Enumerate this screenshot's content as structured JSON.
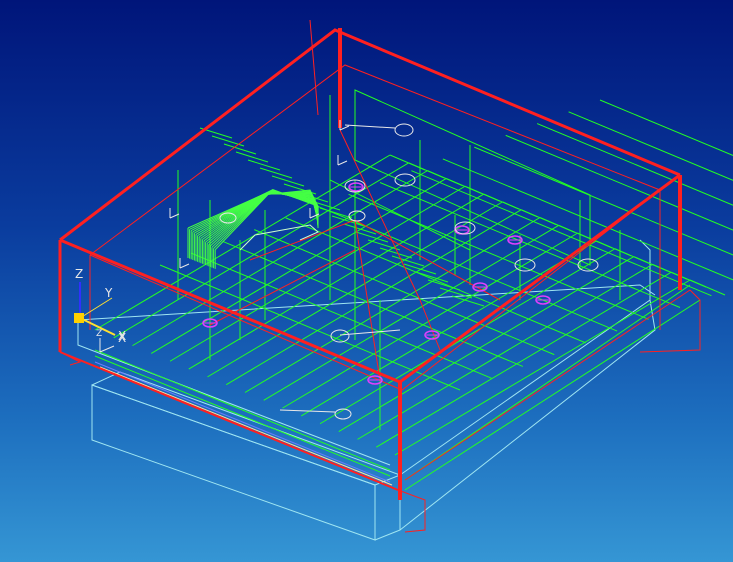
{
  "viewport": {
    "background_top": "#00157a",
    "background_bottom": "#3596d4"
  },
  "colors": {
    "frame": "#ff2020",
    "toolpath": "#22ff22",
    "toolpath_dense": "#44ff44",
    "stock": "#9fe6f2",
    "marker": "#e040ff",
    "annotation": "#e8e8e8",
    "axis_z": "#3030ff",
    "axis_x": "#ffe030",
    "origin": "#ffd000"
  },
  "triad": {
    "z_label": "Z",
    "x_label": "X",
    "y_label": "Y"
  },
  "wcs": {
    "z_label": "Z",
    "x_label": "X"
  },
  "icons": [
    "coordinate-triad-icon",
    "wcs-origin-icon",
    "toolpath-start-marker-icon"
  ]
}
